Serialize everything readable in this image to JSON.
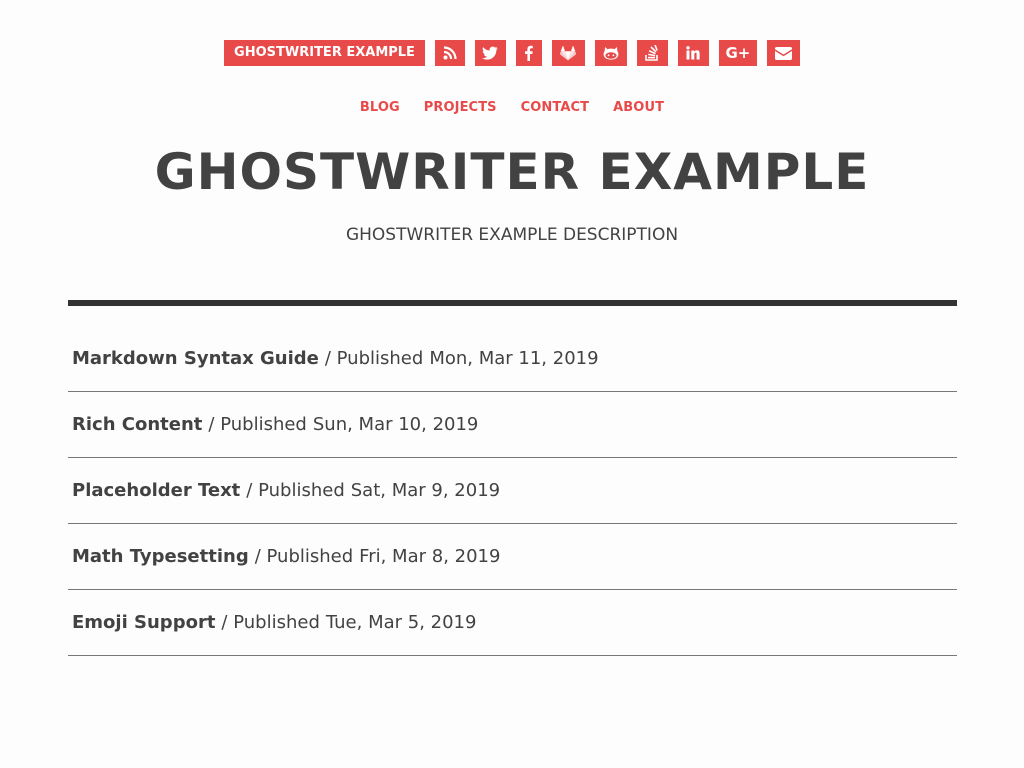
{
  "header": {
    "brand": "GHOSTWRITER EXAMPLE",
    "social": [
      {
        "name": "rss-icon"
      },
      {
        "name": "twitter-icon"
      },
      {
        "name": "facebook-icon"
      },
      {
        "name": "gitlab-icon"
      },
      {
        "name": "github-icon"
      },
      {
        "name": "stackoverflow-icon"
      },
      {
        "name": "linkedin-icon"
      },
      {
        "name": "google-plus-icon",
        "label": "G+"
      },
      {
        "name": "email-icon"
      }
    ]
  },
  "nav": {
    "items": [
      "BLOG",
      "PROJECTS",
      "CONTACT",
      "ABOUT"
    ]
  },
  "site": {
    "title": "GHOSTWRITER EXAMPLE",
    "description": "GHOSTWRITER EXAMPLE DESCRIPTION"
  },
  "posts": {
    "separator": "/ Published",
    "items": [
      {
        "title": "Markdown Syntax Guide",
        "date": "Mon, Mar 11, 2019"
      },
      {
        "title": "Rich Content",
        "date": "Sun, Mar 10, 2019"
      },
      {
        "title": "Placeholder Text",
        "date": "Sat, Mar 9, 2019"
      },
      {
        "title": "Math Typesetting",
        "date": "Fri, Mar 8, 2019"
      },
      {
        "title": "Emoji Support",
        "date": "Tue, Mar 5, 2019"
      }
    ]
  },
  "colors": {
    "accent": "#e84a4a",
    "text": "#424242",
    "rule": "#333333",
    "background": "#fdfdfd"
  }
}
